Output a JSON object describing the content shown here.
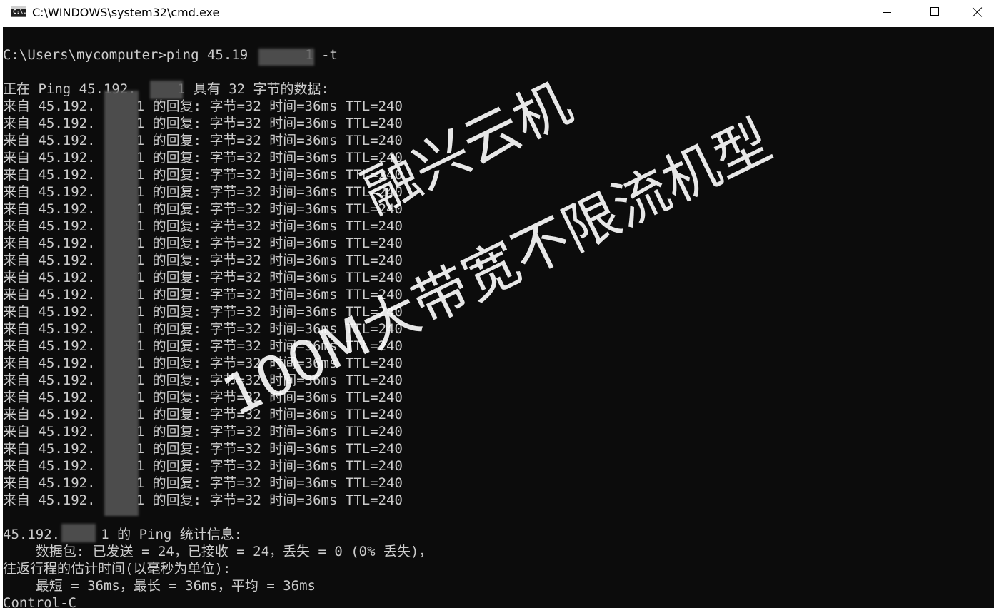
{
  "window": {
    "title": "C:\\WINDOWS\\system32\\cmd.exe",
    "icon_label": "C:\\.",
    "icon": "cmd-icon"
  },
  "controls": {
    "minimize_icon": "minimize-icon",
    "maximize_icon": "maximize-icon",
    "close_icon": "close-icon"
  },
  "console": {
    "lines": [
      "C:\\Users\\mycomputer>ping 45.19       1 -t",
      "",
      "正在 Ping 45.192.     1 具有 32 字节的数据:",
      "来自 45.192.     1 的回复: 字节=32 时间=36ms TTL=240",
      "来自 45.192.     1 的回复: 字节=32 时间=36ms TTL=240",
      "来自 45.192.     1 的回复: 字节=32 时间=36ms TTL=240",
      "来自 45.192.     1 的回复: 字节=32 时间=36ms TTL=240",
      "来自 45.192.     1 的回复: 字节=32 时间=36ms TTL=240",
      "来自 45.192.     1 的回复: 字节=32 时间=36ms TTL=240",
      "来自 45.192.     1 的回复: 字节=32 时间=36ms TTL=240",
      "来自 45.192.     1 的回复: 字节=32 时间=36ms TTL=240",
      "来自 45.192.     1 的回复: 字节=32 时间=36ms TTL=240",
      "来自 45.192.     1 的回复: 字节=32 时间=36ms TTL=240",
      "来自 45.192.     1 的回复: 字节=32 时间=36ms TTL=240",
      "来自 45.192.     1 的回复: 字节=32 时间=36ms TTL=240",
      "来自 45.192.     1 的回复: 字节=32 时间=36ms TTL=240",
      "来自 45.192.     1 的回复: 字节=32 时间=36ms TTL=240",
      "来自 45.192.     1 的回复: 字节=32 时间=36ms TTL=240",
      "来自 45.192.     1 的回复: 字节=32 时间=36ms TTL=240",
      "来自 45.192.     1 的回复: 字节=32 时间=36ms TTL=240",
      "来自 45.192.     1 的回复: 字节=32 时间=36ms TTL=240",
      "来自 45.192.     1 的回复: 字节=32 时间=36ms TTL=240",
      "来自 45.192.     1 的回复: 字节=32 时间=36ms TTL=240",
      "来自 45.192.     1 的回复: 字节=32 时间=36ms TTL=240",
      "来自 45.192.     1 的回复: 字节=32 时间=36ms TTL=240",
      "来自 45.192.     1 的回复: 字节=32 时间=36ms TTL=240",
      "来自 45.192.     1 的回复: 字节=32 时间=36ms TTL=240",
      "",
      "45.192.     1 的 Ping 统计信息:",
      "    数据包: 已发送 = 24，已接收 = 24，丢失 = 0 (0% 丢失)，",
      "往返行程的估计时间(以毫秒为单位):",
      "    最短 = 36ms，最长 = 36ms，平均 = 36ms",
      "Control-C"
    ]
  },
  "watermark": {
    "line1": "融兴云机",
    "line2": "100M大带宽不限流机型"
  },
  "colors": {
    "console_background": "#0c0c0c",
    "console_text": "#cccccc",
    "titlebar_background": "#ffffff",
    "watermark_text": "#ffffff"
  }
}
